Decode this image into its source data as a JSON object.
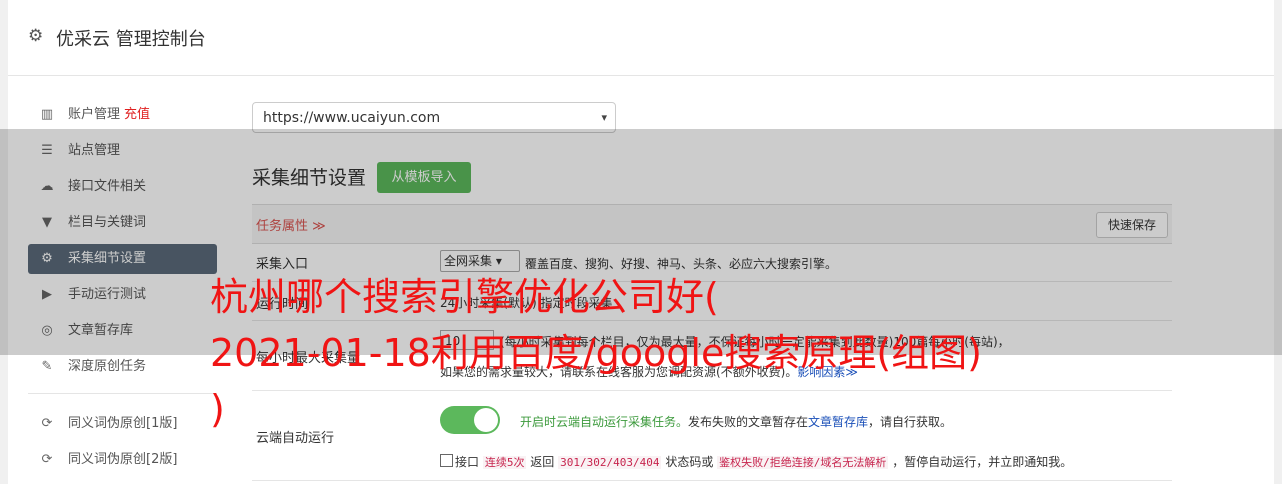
{
  "header": {
    "title": "优采云 管理控制台",
    "icon": "gear-icon"
  },
  "sidebar": {
    "items": [
      {
        "label": "账户管理",
        "badge": "充值",
        "icon": "bar-chart-icon"
      },
      {
        "label": "站点管理",
        "icon": "server-icon"
      },
      {
        "label": "接口文件相关",
        "icon": "cloud-upload-icon"
      },
      {
        "label": "栏目与关键词",
        "icon": "filter-icon"
      },
      {
        "label": "采集细节设置",
        "icon": "gears-icon",
        "active": true
      },
      {
        "label": "手动运行测试",
        "icon": "play-circle-icon"
      },
      {
        "label": "文章暂存库",
        "icon": "database-icon"
      },
      {
        "label": "深度原创任务",
        "icon": "edit-icon"
      },
      {
        "label": "同义词伪原创[1版]",
        "icon": "refresh-icon"
      },
      {
        "label": "同义词伪原创[2版]",
        "icon": "refresh-icon"
      }
    ]
  },
  "site_select": {
    "value": "https://www.ucaiyun.com"
  },
  "section": {
    "title": "采集细节设置",
    "import_button": "从模板导入",
    "task_attr": "任务属性 ≫",
    "save_button": "快速保存"
  },
  "rows": {
    "collect_entry": {
      "label": "采集入口",
      "select_value": "全网采集",
      "desc": "覆盖百度、搜狗、好搜、神马、头条、必应六大搜索引擎。"
    },
    "run_time": {
      "label": "运行时间",
      "desc": "24小时采集(默认)   指定时段采集"
    },
    "max_collect": {
      "label": "每小时最大采集量",
      "input_value": "10",
      "desc": "(每小时采集到每个栏目，仅为最大量，不保证每小时一定能采集到此数量)100篇每小时(每站)，",
      "desc2": "如果您的需求量较大，请联系在线客服为您调配资源(不额外收费)。",
      "link": "影响因素≫"
    },
    "cloud_run": {
      "label": "云端自动运行",
      "toggle_on": true,
      "status": "开启时云端自动运行采集任务。",
      "note1": "发布失败的文章暂存在",
      "note_link": "文章暂存库",
      "note2": "，请自行获取。",
      "line2_a": "接口",
      "code1": "连续5次",
      "line2_b": "返回",
      "code2": "301/302/403/404",
      "line2_c": "状态码或",
      "code3": "鉴权失败/拒绝连接/域名无法解析",
      "line2_d": "，暂停自动运行，并立即通知我。"
    }
  },
  "watermark": {
    "line1": "杭州哪个搜索引擎优化公司好(",
    "line2": "2021-01-18利用百度/google搜索原理(组图)",
    "line3": ")"
  },
  "colors": {
    "accent_green": "#5cb85c",
    "active_nav": "#5a6a7a",
    "danger": "#d9534f",
    "watermark": "#f01414"
  }
}
